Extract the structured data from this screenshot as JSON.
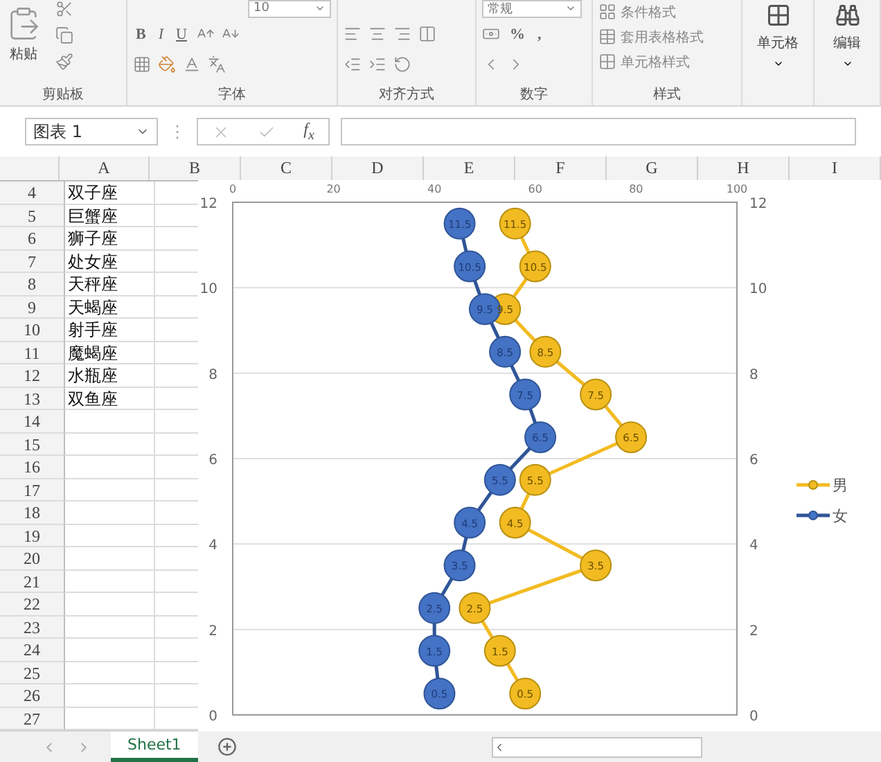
{
  "ribbon": {
    "clipboard": {
      "paste_label": "粘贴",
      "group_label": "剪贴板"
    },
    "font": {
      "size": "10",
      "style_buttons": [
        "B",
        "I",
        "U"
      ],
      "group_label": "字体"
    },
    "alignment": {
      "group_label": "对齐方式"
    },
    "number": {
      "format": "常规",
      "buttons": [
        "%",
        ","
      ],
      "group_label": "数字"
    },
    "styles": {
      "items": [
        "条件格式",
        "套用表格格式",
        "单元格样式"
      ],
      "group_label": "样式"
    },
    "cells": {
      "label": "单元格"
    },
    "editing": {
      "label": "编辑"
    }
  },
  "formula_bar": {
    "name_box": "图表 1",
    "separator": "⋮",
    "fx": "f$_{x}$"
  },
  "sheet": {
    "columns": [
      "A",
      "B",
      "C",
      "D",
      "E",
      "F",
      "G",
      "H",
      "I"
    ],
    "rows": [
      {
        "number": "4",
        "a": "双子座"
      },
      {
        "number": "5",
        "a": "巨蟹座"
      },
      {
        "number": "6",
        "a": "狮子座"
      },
      {
        "number": "7",
        "a": "处女座"
      },
      {
        "number": "8",
        "a": "天秤座"
      },
      {
        "number": "9",
        "a": "天蝎座"
      },
      {
        "number": "10",
        "a": "射手座"
      },
      {
        "number": "11",
        "a": "魔蝎座"
      },
      {
        "number": "12",
        "a": "水瓶座"
      },
      {
        "number": "13",
        "a": "双鱼座"
      },
      {
        "number": "14"
      },
      {
        "number": "15"
      },
      {
        "number": "16"
      },
      {
        "number": "17"
      },
      {
        "number": "18"
      },
      {
        "number": "19"
      },
      {
        "number": "20"
      },
      {
        "number": "21"
      },
      {
        "number": "22"
      },
      {
        "number": "23"
      },
      {
        "number": "24"
      },
      {
        "number": "25"
      },
      {
        "number": "26"
      },
      {
        "number": "27"
      }
    ]
  },
  "chart": {
    "chart_data": {
      "type": "line",
      "series": [
        {
          "name": "男",
          "color": "#f2bb22",
          "marker": "circle",
          "x": [
            58,
            53,
            48,
            72,
            56,
            60,
            79,
            72,
            62,
            54,
            60,
            56
          ],
          "values": [
            0.5,
            1.5,
            2.5,
            3.5,
            4.5,
            5.5,
            6.5,
            7.5,
            8.5,
            9.5,
            10.5,
            11.5
          ]
        },
        {
          "name": "女",
          "color": "#4472c4",
          "marker": "circle",
          "x": [
            41,
            40,
            40,
            45,
            47,
            53,
            61,
            58,
            54,
            50,
            47,
            45
          ],
          "values": [
            0.5,
            1.5,
            2.5,
            3.5,
            4.5,
            5.5,
            6.5,
            7.5,
            8.5,
            9.5,
            10.5,
            11.5
          ]
        }
      ],
      "xlim": [
        0,
        100
      ],
      "ylim": [
        0,
        12
      ],
      "xticks": [
        0,
        20,
        40,
        60,
        80,
        100
      ],
      "yticks": [
        0,
        2,
        4,
        6,
        8,
        10,
        12
      ],
      "data_labels": true,
      "legend": "right",
      "grid": true
    },
    "left_axis_labels": [
      "12",
      "10",
      "8",
      "6",
      "4",
      "2",
      "0"
    ]
  },
  "sheet_tabs": [
    {
      "label": "Sheet1",
      "selected": true
    }
  ]
}
